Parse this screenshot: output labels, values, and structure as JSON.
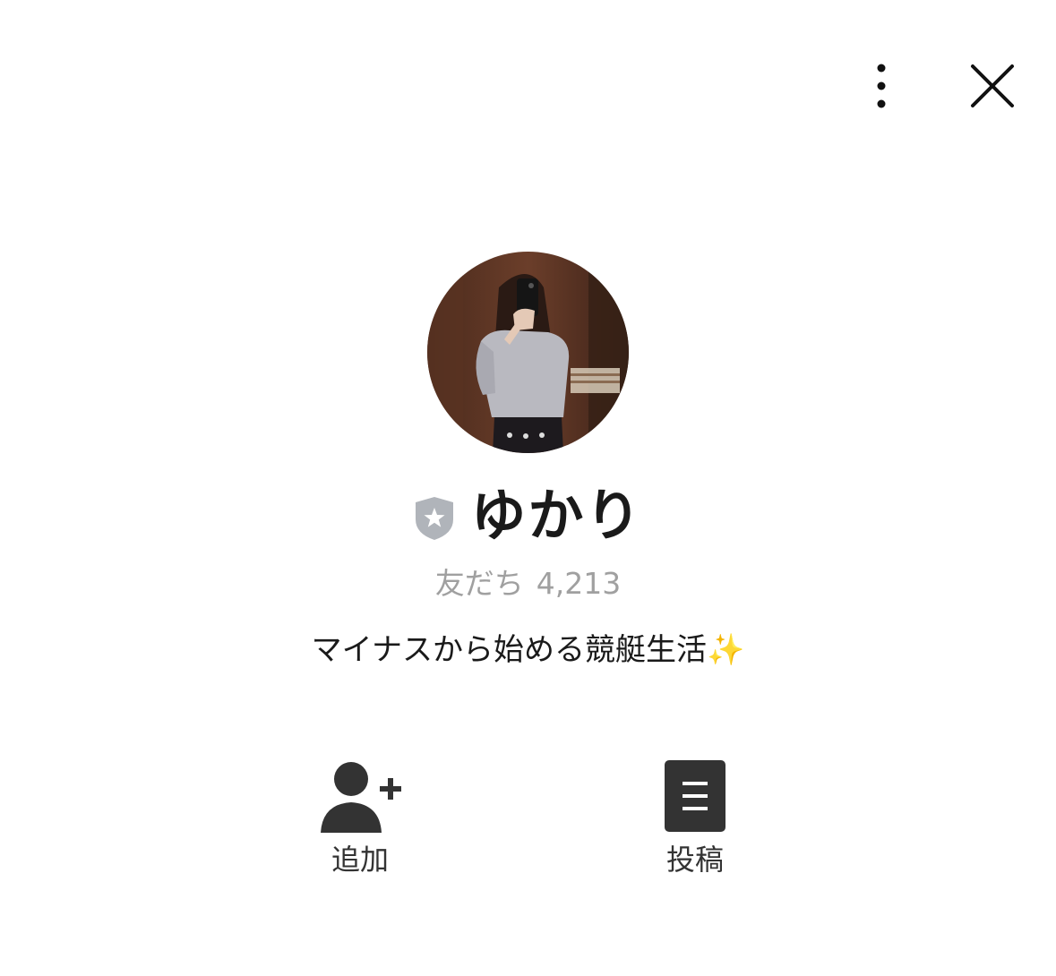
{
  "header": {
    "more_icon": "vertical-ellipsis-icon",
    "close_icon": "close-x-icon"
  },
  "profile": {
    "avatar_icon": "profile-photo",
    "badge_icon": "shield-star-icon",
    "name": "ゆかり",
    "friends_label": "友だち",
    "friends_count": "4,213",
    "status_message": "マイナスから始める競艇生活✨"
  },
  "actions": [
    {
      "label": "追加",
      "icon": "add-friend-icon"
    },
    {
      "label": "投稿",
      "icon": "post-document-icon"
    }
  ],
  "colors": {
    "text": "#1a1a1a",
    "muted": "#a0a0a0",
    "icon": "#333333",
    "badge": "#b0b4ba"
  }
}
